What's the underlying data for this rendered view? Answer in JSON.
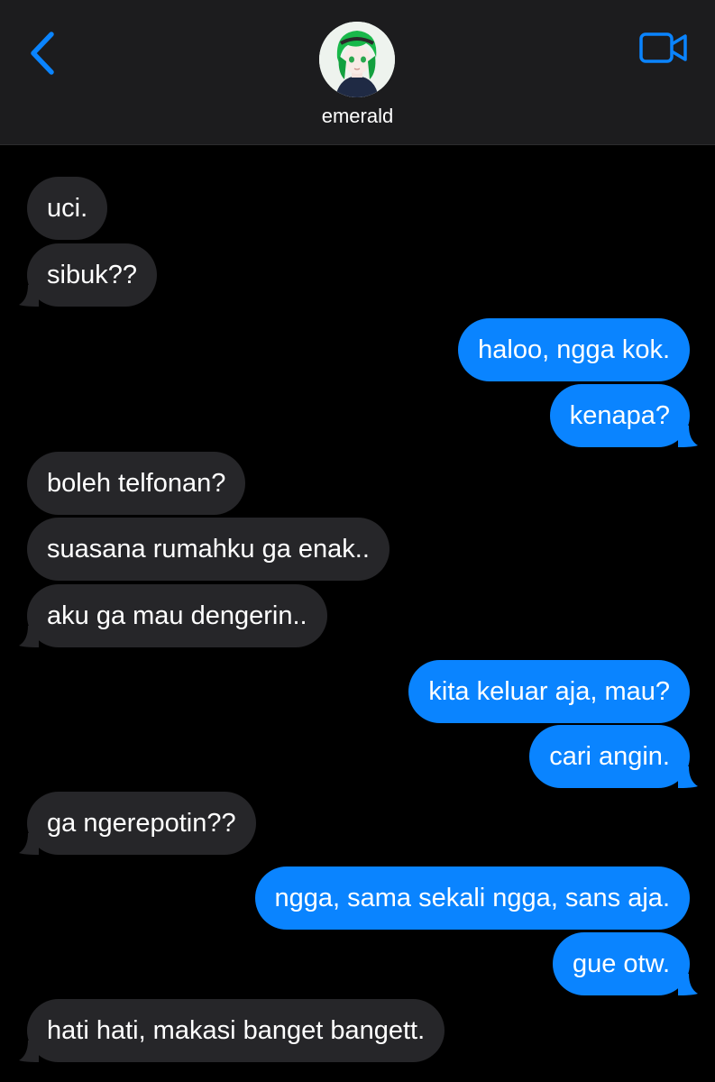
{
  "header": {
    "contact_name": "emerald",
    "back_icon": "chevron-left-icon",
    "video_icon": "video-camera-icon",
    "accent_color": "#0a84ff"
  },
  "messages": [
    {
      "direction": "incoming",
      "text": "uci."
    },
    {
      "direction": "incoming",
      "text": "sibuk??"
    },
    {
      "direction": "outgoing",
      "text": "haloo, ngga kok."
    },
    {
      "direction": "outgoing",
      "text": "kenapa?"
    },
    {
      "direction": "incoming",
      "text": "boleh telfonan?"
    },
    {
      "direction": "incoming",
      "text": "suasana rumahku ga enak.."
    },
    {
      "direction": "incoming",
      "text": "aku ga mau dengerin.."
    },
    {
      "direction": "outgoing",
      "text": "kita keluar aja, mau?"
    },
    {
      "direction": "outgoing",
      "text": "cari angin."
    },
    {
      "direction": "incoming",
      "text": "ga ngerepotin??"
    },
    {
      "direction": "outgoing",
      "text": "ngga, sama sekali ngga, sans aja."
    },
    {
      "direction": "outgoing",
      "text": "gue otw."
    },
    {
      "direction": "incoming",
      "text": "hati hati, makasi banget bangett."
    }
  ],
  "colors": {
    "incoming_bubble": "#262629",
    "outgoing_bubble": "#0a84ff",
    "header_bg": "#1c1c1e"
  }
}
